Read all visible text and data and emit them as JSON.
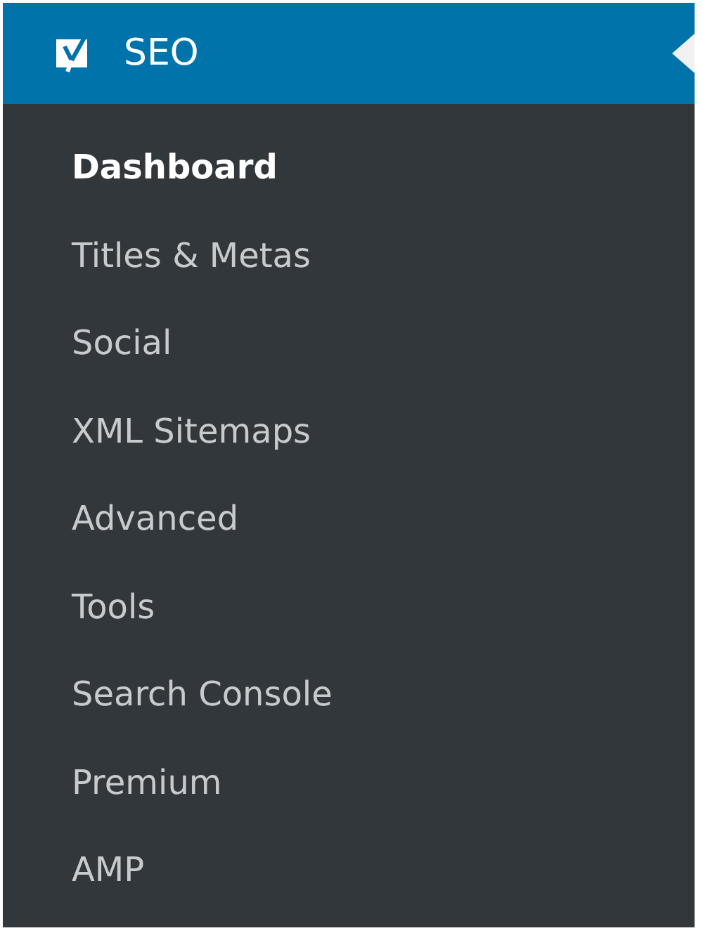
{
  "menu": {
    "title": "SEO",
    "current": true
  },
  "items": [
    {
      "label": "Dashboard",
      "selected": true
    },
    {
      "label": "Titles & Metas",
      "selected": false
    },
    {
      "label": "Social",
      "selected": false
    },
    {
      "label": "XML Sitemaps",
      "selected": false
    },
    {
      "label": "Advanced",
      "selected": false
    },
    {
      "label": "Tools",
      "selected": false
    },
    {
      "label": "Search Console",
      "selected": false
    },
    {
      "label": "Premium",
      "selected": false
    },
    {
      "label": "AMP",
      "selected": false
    }
  ]
}
